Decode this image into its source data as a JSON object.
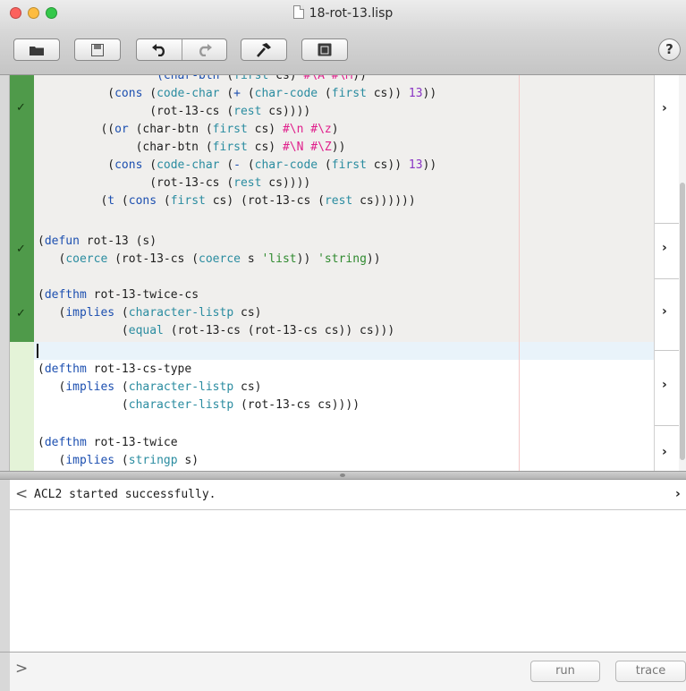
{
  "window": {
    "title": "18-rot-13.lisp"
  },
  "toolbar": {
    "buttons": [
      "folder-icon",
      "save-icon",
      "undo-icon",
      "redo-icon",
      "hammer-icon",
      "console-icon"
    ],
    "help_label": "?"
  },
  "editor": {
    "blocks": [
      {
        "status": "done",
        "check": "✓",
        "lines": [
          "                 (char-btn (first cs) #\\A #\\M))",
          "          (cons (code-char (+ (char-code (first cs)) 13))",
          "                (rot-13-cs (rest cs))))",
          "         ((or (char-btn (first cs) #\\n #\\z)",
          "              (char-btn (first cs) #\\N #\\Z))",
          "          (cons (code-char (- (char-code (first cs)) 13))",
          "                (rot-13-cs (rest cs))))",
          "         (t (cons (first cs) (rot-13-cs (rest cs))))))"
        ]
      },
      {
        "status": "done",
        "check": "✓",
        "lines": [
          "(defun rot-13 (s)",
          "   (coerce (rot-13-cs (coerce s 'list)) 'string))"
        ]
      },
      {
        "status": "done",
        "check": "✓",
        "lines": [
          "(defthm rot-13-twice-cs",
          "   (implies (character-listp cs)",
          "            (equal (rot-13-cs (rot-13-cs cs)) cs)))"
        ]
      },
      {
        "status": "todo",
        "lines": [
          "(defthm rot-13-cs-type",
          "   (implies (character-listp cs)",
          "            (character-listp (rot-13-cs cs))))"
        ]
      },
      {
        "status": "todo",
        "lines": [
          "(defthm rot-13-twice",
          "   (implies (stringp s)"
        ]
      }
    ],
    "expand_chevron": "›"
  },
  "output": {
    "prev_label": "<",
    "message": "ACL2 started successfully.",
    "next_label": "›"
  },
  "input": {
    "prompt": ">",
    "value": "",
    "run_label": "run",
    "trace_label": "trace"
  },
  "colors": {
    "proved_gutter": "#4f9a4a",
    "pending_gutter": "#e4f3d8",
    "keyword": "#1c4fb0",
    "function": "#2a8ca0",
    "char_literal": "#e0208c",
    "number": "#8a35c4",
    "quoted": "#2f8a2f"
  }
}
